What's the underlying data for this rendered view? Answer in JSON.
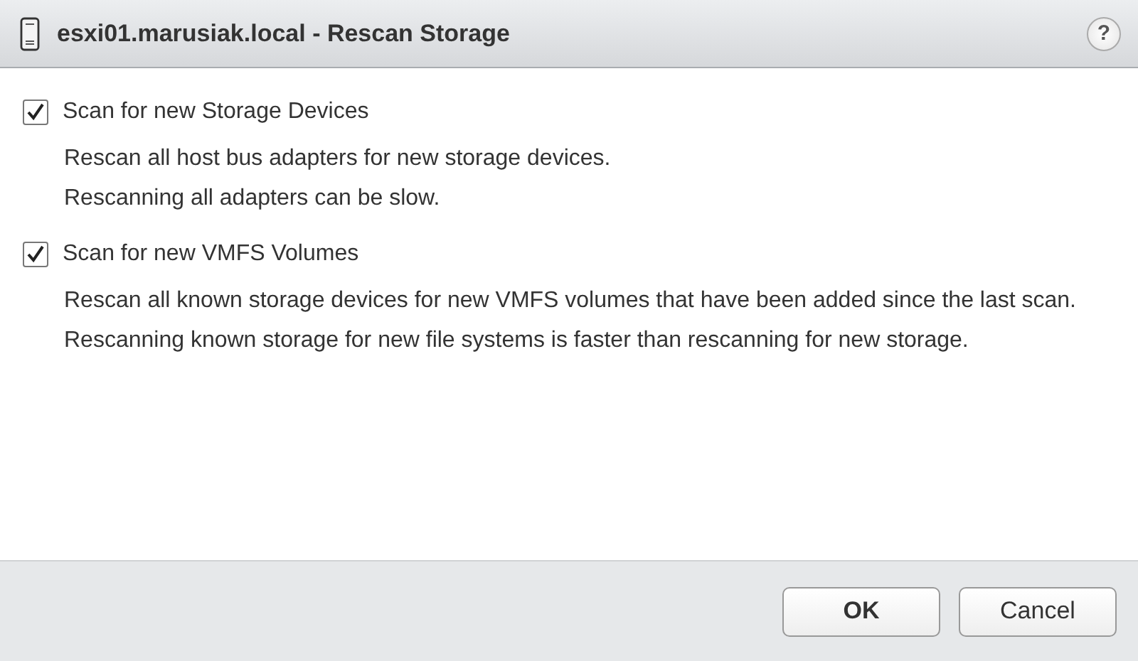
{
  "window": {
    "title": "esxi01.marusiak.local - Rescan Storage",
    "help": "?"
  },
  "options": [
    {
      "label": "Scan for new Storage Devices",
      "checked": true,
      "description": [
        "Rescan all host bus adapters for new storage devices.",
        "Rescanning all adapters can be slow."
      ]
    },
    {
      "label": "Scan for new VMFS Volumes",
      "checked": true,
      "description": [
        "Rescan all known storage devices for new VMFS volumes that have been added since the last scan. Rescanning known storage for new file systems is faster than rescanning for new storage."
      ]
    }
  ],
  "buttons": [
    {
      "label": "OK",
      "kind": "primary"
    },
    {
      "label": "Cancel",
      "kind": "secondary"
    }
  ]
}
